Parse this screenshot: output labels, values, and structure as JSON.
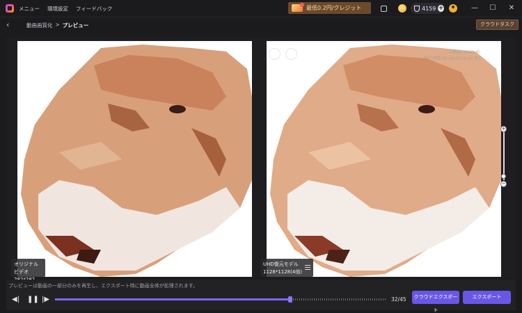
{
  "menu": {
    "items": [
      "メニュー",
      "環境設定",
      "フィードバック"
    ]
  },
  "promo": {
    "text": "最低0.2円/クレジット"
  },
  "credits": {
    "count": "4159"
  },
  "subbar": {
    "breadcrumb_parent": "動画画質化",
    "breadcrumb_sep": ">",
    "breadcrumb_current": "プレビュー",
    "cloud_task_label": "クラウドタスク"
  },
  "preview": {
    "left_label_title": "オリジナルビデオ",
    "left_label_size": "282*282",
    "right_label_title": "UHD復元モデル",
    "right_label_size": "1128*1128(4倍)",
    "overlay_line1": "元動画 46/45 秒",
    "overlay_line2": "残り時間 00:00:00 (0.00 秒)"
  },
  "bottom": {
    "hint": "プレビューは動画の一部分のみを再生し、エクスポート時に動画全体が処理されます。",
    "frame_count": "32/45",
    "progress_fraction": 0.7111,
    "cloud_export_label": "クラウドエクスポート",
    "export_label": "エクスポート"
  },
  "colors": {
    "accent": "#6a56e6",
    "promo_bg": "#6b4a2c",
    "cloud_task_bg": "#5a4233"
  },
  "icons": {
    "back": "chevron-left-icon",
    "prev": "skip-back-icon",
    "play_pause": "pause-icon",
    "next": "skip-forward-icon",
    "minimize": "minimize-icon",
    "maximize": "maximize-icon",
    "close": "close-icon"
  }
}
